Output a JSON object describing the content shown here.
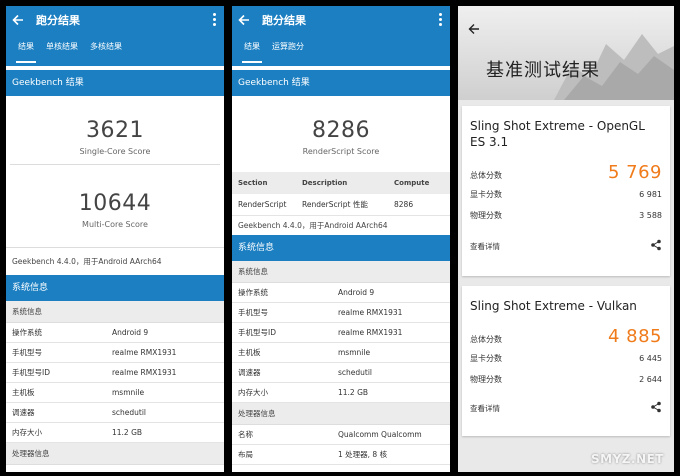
{
  "panel1": {
    "title": "跑分结果",
    "tabs": [
      "结果",
      "单核结果",
      "多核结果"
    ],
    "section": "Geekbench 结果",
    "single_score": "3621",
    "single_label": "Single-Core Score",
    "multi_score": "10644",
    "multi_label": "Multi-Core Score",
    "note": "Geekbench 4.4.0，用于Android AArch64",
    "sysinfo_head": "系统信息",
    "sysinfo_sub": "系统信息",
    "rows": [
      {
        "k": "操作系统",
        "v": "Android 9"
      },
      {
        "k": "手机型号",
        "v": "realme RMX1931"
      },
      {
        "k": "手机型号ID",
        "v": "realme RMX1931"
      },
      {
        "k": "主机板",
        "v": "msmnile"
      },
      {
        "k": "调速器",
        "v": "schedutil"
      },
      {
        "k": "内存大小",
        "v": "11.2 GB"
      }
    ],
    "cpu_sub": "处理器信息"
  },
  "panel2": {
    "title": "跑分结果",
    "tabs": [
      "结果",
      "运算跑分"
    ],
    "section": "Geekbench 结果",
    "score": "8286",
    "score_label": "RenderScript Score",
    "table_head": [
      "Section",
      "Description",
      "Compute"
    ],
    "table_row": [
      "RenderScript",
      "RenderScript 性能",
      "8286"
    ],
    "note": "Geekbench 4.4.0，用于Android AArch64",
    "sysinfo_head": "系统信息",
    "sysinfo_sub": "系统信息",
    "rows": [
      {
        "k": "操作系统",
        "v": "Android 9"
      },
      {
        "k": "手机型号",
        "v": "realme RMX1931"
      },
      {
        "k": "手机型号ID",
        "v": "realme RMX1931"
      },
      {
        "k": "主机板",
        "v": "msmnile"
      },
      {
        "k": "调速器",
        "v": "schedutil"
      },
      {
        "k": "内存大小",
        "v": "11.2 GB"
      }
    ],
    "cpu_sub": "处理器信息",
    "cpu_rows": [
      {
        "k": "名称",
        "v": "Qualcomm Qualcomm"
      },
      {
        "k": "布局",
        "v": "1 处理器, 8 核"
      }
    ]
  },
  "panel3": {
    "title": "基准测试结果",
    "cards": [
      {
        "name": "Sling Shot Extreme - OpenGL ES 3.1",
        "total_label": "总体分数",
        "total": "5 769",
        "gpu_label": "显卡分数",
        "gpu": "6 981",
        "phys_label": "物理分数",
        "phys": "3 588",
        "details": "查看详情"
      },
      {
        "name": "Sling Shot Extreme - Vulkan",
        "total_label": "总体分数",
        "total": "4 885",
        "gpu_label": "显卡分数",
        "gpu": "6 445",
        "phys_label": "物理分数",
        "phys": "2 644",
        "details": "查看详情"
      }
    ],
    "watermark": "SMYZ.NET"
  },
  "colors": {
    "accent": "#1b7fc2",
    "score_orange": "#f07b1a"
  }
}
